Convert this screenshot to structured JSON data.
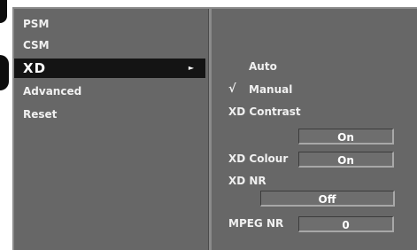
{
  "menu": {
    "items": [
      {
        "label": "PSM"
      },
      {
        "label": "CSM"
      },
      {
        "label": "XD",
        "arrow": "►",
        "selected": true
      },
      {
        "label": "Advanced"
      },
      {
        "label": "Reset"
      }
    ]
  },
  "submenu": {
    "modes": {
      "auto": "Auto",
      "manual": "Manual",
      "check_mark": "√",
      "selected": "Manual"
    },
    "xd_contrast": {
      "label": "XD Contrast",
      "value": "On"
    },
    "xd_colour": {
      "label": "XD Colour",
      "value": "On"
    },
    "xd_nr": {
      "label": "XD NR",
      "value": "Off"
    },
    "mpeg_nr": {
      "label": "MPEG NR",
      "value": "0"
    }
  },
  "colors": {
    "menu_background": "#676767",
    "selected_background": "#141414",
    "text": "#f0f0f0"
  }
}
